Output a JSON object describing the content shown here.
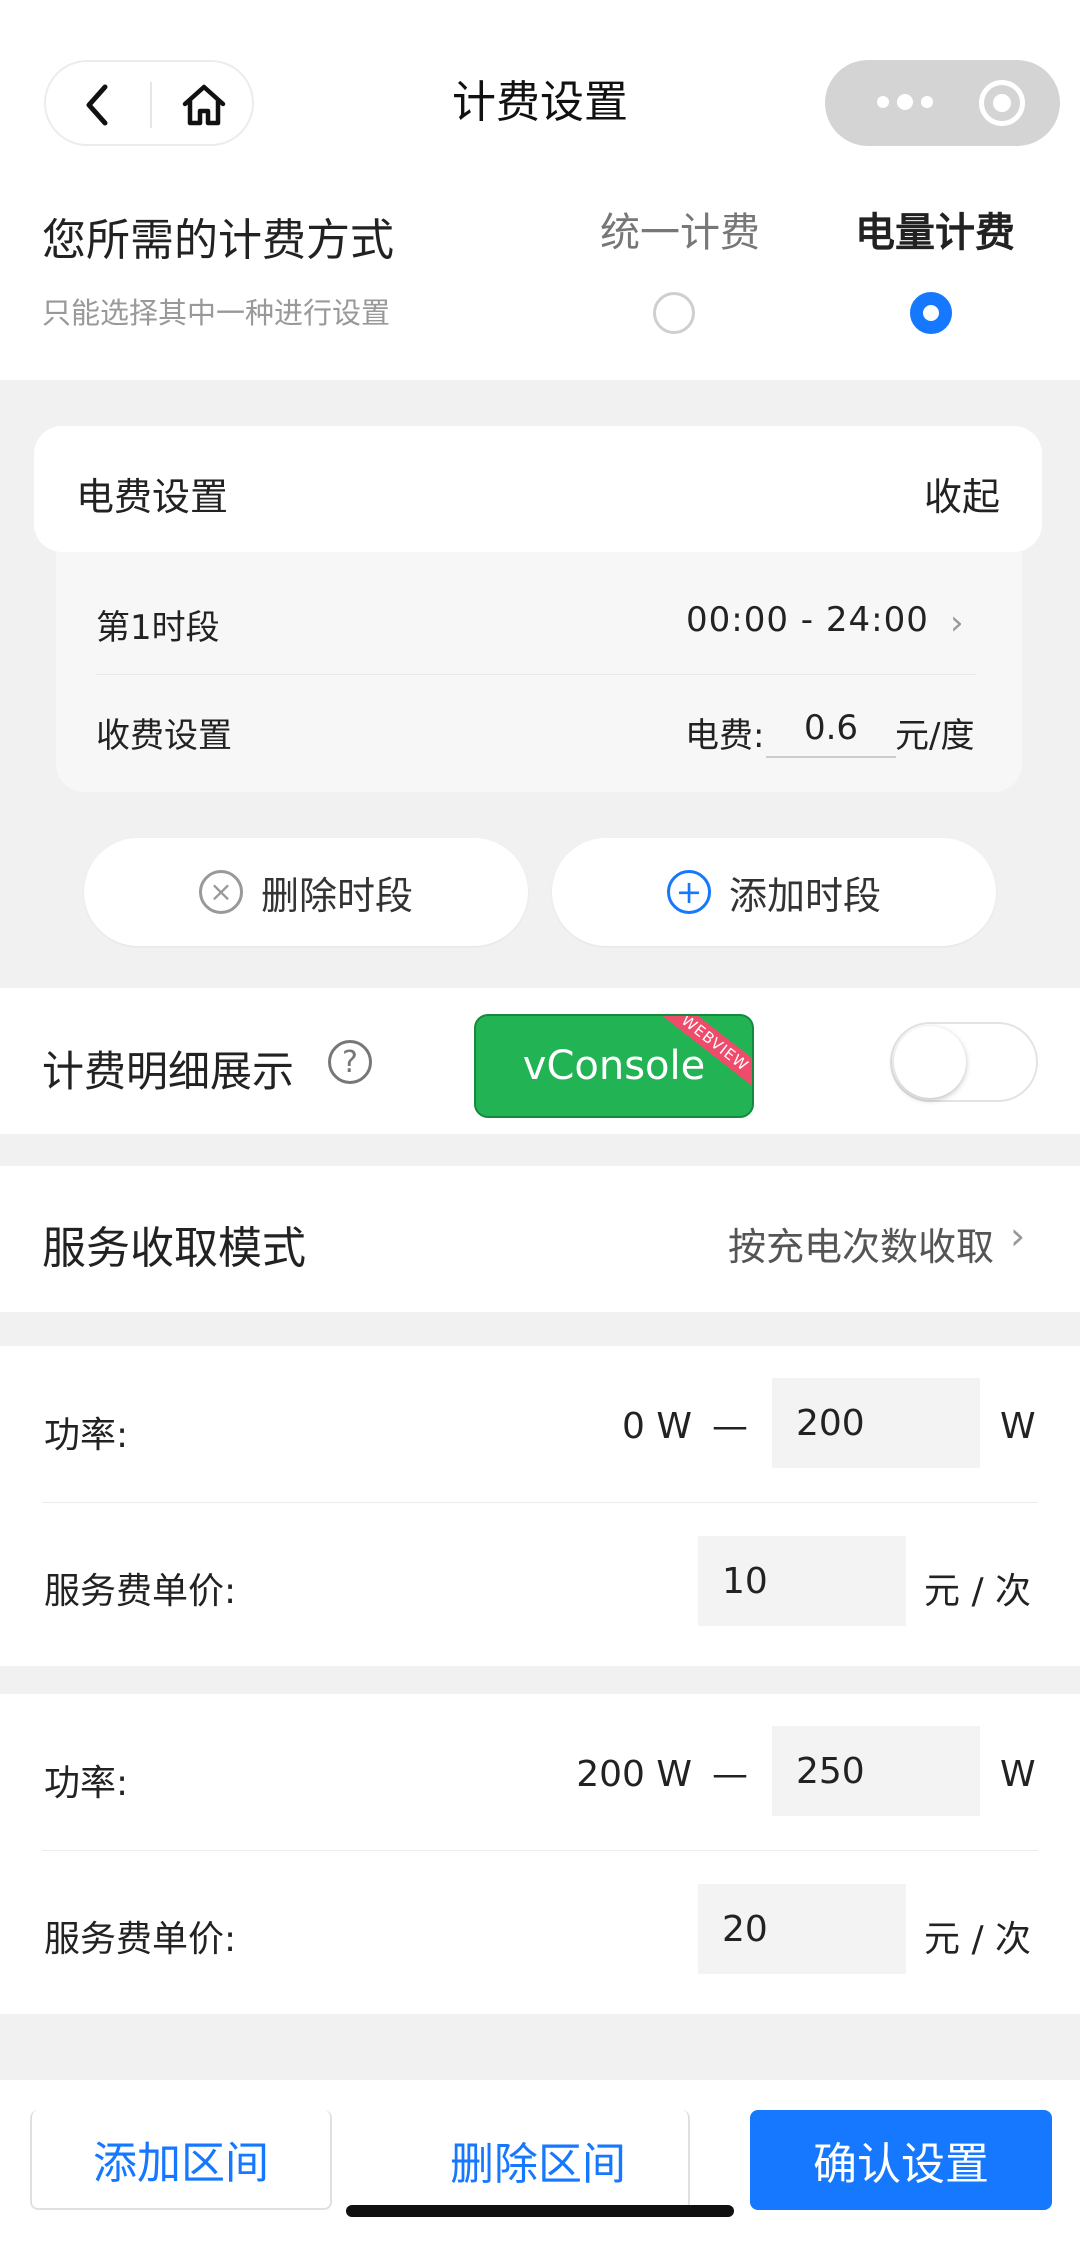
{
  "nav": {
    "title": "计费设置"
  },
  "billing_mode": {
    "title": "您所需的计费方式",
    "hint": "只能选择其中一种进行设置",
    "options": [
      {
        "label": "统一计费",
        "selected": false
      },
      {
        "label": "电量计费",
        "selected": true
      }
    ]
  },
  "fee_settings": {
    "title": "电费设置",
    "collapse_label": "收起",
    "slot_label": "第1时段",
    "slot_time": "00:00 - 24:00",
    "charge_label": "收费设置",
    "charge_prefix": "电费:",
    "charge_value": "0.6",
    "charge_unit": "元/度",
    "delete_slot_label": "删除时段",
    "add_slot_label": "添加时段"
  },
  "detail_display": {
    "label": "计费明细展示",
    "enabled": false
  },
  "vconsole": {
    "label": "vConsole",
    "ribbon": "WEBVIEW"
  },
  "service_mode": {
    "label": "服务收取模式",
    "value": "按充电次数收取"
  },
  "tiers": [
    {
      "power_label": "功率:",
      "power_from": "0 W",
      "separator": "—",
      "power_to": "200",
      "power_unit": "W",
      "price_label": "服务费单价:",
      "price": "10",
      "price_unit": "元 / 次"
    },
    {
      "power_label": "功率:",
      "power_from": "200 W",
      "separator": "—",
      "power_to": "250",
      "power_unit": "W",
      "price_label": "服务费单价:",
      "price": "20",
      "price_unit": "元 / 次"
    }
  ],
  "bottom": {
    "add_range": "添加区间",
    "delete_range": "删除区间",
    "confirm": "确认设置"
  },
  "colors": {
    "accent": "#1677ff",
    "vconsole": "#22b454"
  }
}
